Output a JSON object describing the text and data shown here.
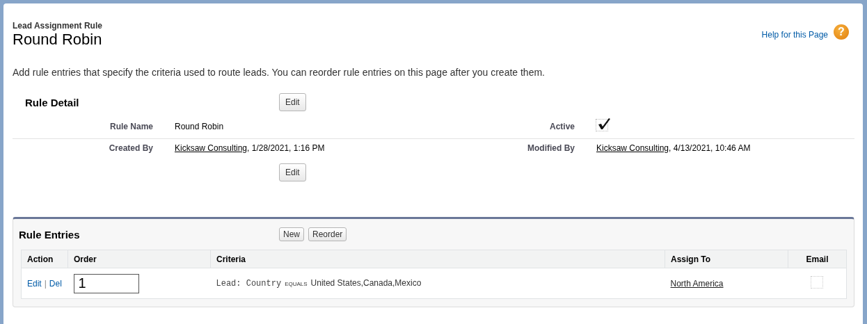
{
  "header": {
    "breadcrumb": "Lead Assignment Rule",
    "title": "Round Robin",
    "help_link": "Help for this Page",
    "help_icon": "?"
  },
  "description": "Add rule entries that specify the criteria used to route leads. You can reorder rule entries on this page after you create them.",
  "rule_detail": {
    "title": "Rule Detail",
    "top_buttons": [
      "Edit"
    ],
    "bottom_buttons": [
      "Edit"
    ],
    "fields": [
      {
        "label": "Rule Name",
        "kind": "text",
        "value": "Round Robin"
      },
      {
        "label": "Active",
        "kind": "checkbox",
        "checked": true
      },
      {
        "label": "Created By",
        "kind": "user",
        "link": "Kicksaw Consulting",
        "value": ", 1/28/2021, 1:16 PM"
      },
      {
        "label": "Modified By",
        "kind": "user",
        "link": "Kicksaw Consulting",
        "value": ", 4/13/2021, 10:46 AM"
      }
    ]
  },
  "rule_entries": {
    "title": "Rule Entries",
    "buttons": [
      "New",
      "Reorder"
    ],
    "columns": [
      "Action",
      "Order",
      "Criteria",
      "Assign To",
      "Email"
    ],
    "rows": [
      {
        "actions": [
          "Edit",
          "Del"
        ],
        "separator": "|",
        "order": "1",
        "criteria_field": "Lead: Country",
        "criteria_operator": "EQUALS",
        "criteria_value": "United States,Canada,Mexico",
        "assign_to": "North America",
        "email": false
      }
    ]
  }
}
